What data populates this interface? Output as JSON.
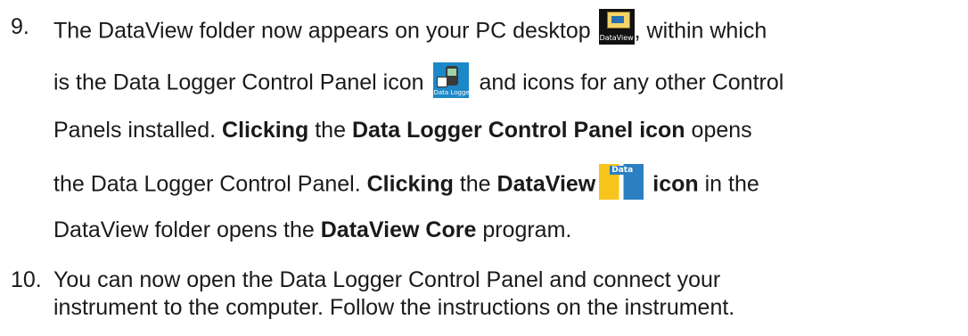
{
  "step9": {
    "number": "9.",
    "l1_a": "The DataView folder now appears on your PC desktop",
    "l1_b": ", within which",
    "l2_a": "is the Data Logger Control Panel icon",
    "l2_b": "and icons for any other Control",
    "l3_a": "Panels installed.",
    "l3_b": "Clicking",
    "l3_c": "the",
    "l3_d": "Data Logger Control Panel icon",
    "l3_e": "opens",
    "l4_a": "the Data Logger Control Panel.",
    "l4_b": "Clicking",
    "l4_c": "the",
    "l4_d": "DataView",
    "l4_e": "icon",
    "l4_f": "in the",
    "l5_a": "DataView folder opens the",
    "l5_b": "DataView Core",
    "l5_c": "program."
  },
  "step10": {
    "number": "10.",
    "l1": "You can now open the Data Logger Control Panel and connect your",
    "l2": "instrument to the computer. Follow the instructions on the instrument."
  },
  "icons": {
    "folder_caption": "DataView",
    "logger_caption": "Data Logger",
    "dataview_caption": "Data"
  }
}
